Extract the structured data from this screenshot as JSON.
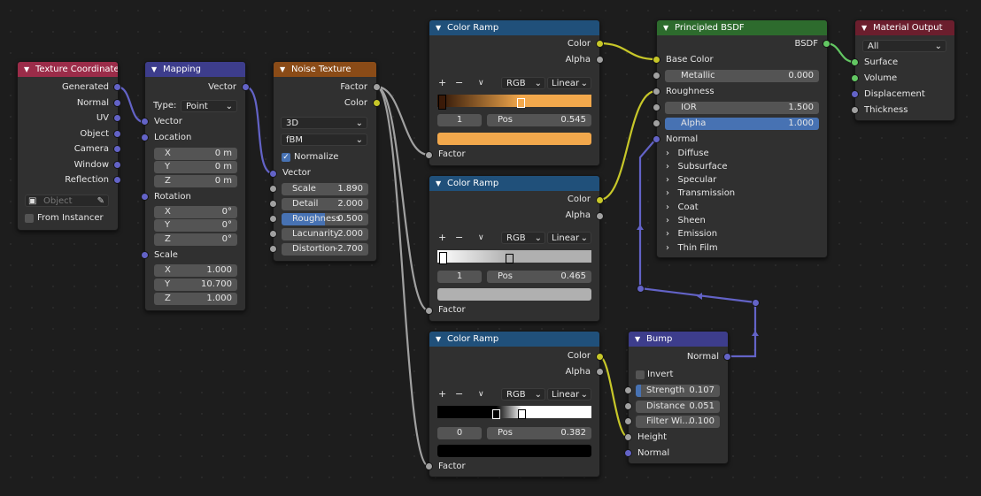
{
  "colors": {
    "frame_red": "#9b2c49",
    "vector_blue": "#3d3d8c",
    "texture_orange": "#8a4b17",
    "converter_blue": "#20507a",
    "shader_green": "#2d6b2d",
    "output_red": "#6b1e2d"
  },
  "texture_coordinate": {
    "title": "Texture Coordinate",
    "outputs": [
      "Generated",
      "Normal",
      "UV",
      "Object",
      "Camera",
      "Window",
      "Reflection"
    ],
    "object_placeholder": "Object",
    "from_instancer": "From Instancer"
  },
  "mapping": {
    "title": "Mapping",
    "out_vector": "Vector",
    "type_label": "Type:",
    "type_value": "Point",
    "in_vector": "Vector",
    "location": "Location",
    "rotation": "Rotation",
    "scale": "Scale",
    "loc": [
      {
        "a": "X",
        "v": "0 m"
      },
      {
        "a": "Y",
        "v": "0 m"
      },
      {
        "a": "Z",
        "v": "0 m"
      }
    ],
    "rot": [
      {
        "a": "X",
        "v": "0°"
      },
      {
        "a": "Y",
        "v": "0°"
      },
      {
        "a": "Z",
        "v": "0°"
      }
    ],
    "scl": [
      {
        "a": "X",
        "v": "1.000"
      },
      {
        "a": "Y",
        "v": "10.700"
      },
      {
        "a": "Z",
        "v": "1.000"
      }
    ]
  },
  "noise": {
    "title": "Noise Texture",
    "out_factor": "Factor",
    "out_color": "Color",
    "dim": "3D",
    "type": "fBM",
    "normalize": "Normalize",
    "in_vector": "Vector",
    "params": [
      {
        "k": "Scale",
        "v": "1.890"
      },
      {
        "k": "Detail",
        "v": "2.000"
      },
      {
        "k": "Roughness",
        "v": "0.500"
      },
      {
        "k": "Lacunarity",
        "v": "2.000"
      },
      {
        "k": "Distortion",
        "v": "-2.700"
      }
    ]
  },
  "ramp1": {
    "title": "Color Ramp",
    "color": "Color",
    "alpha": "Alpha",
    "plus": "+",
    "minus": "−",
    "chev": "∨",
    "mode": "RGB",
    "interp": "Linear",
    "index": "1",
    "pos_label": "Pos",
    "pos": "0.545",
    "factor": "Factor",
    "swatch": "#f2a84c"
  },
  "ramp2": {
    "title": "Color Ramp",
    "color": "Color",
    "alpha": "Alpha",
    "plus": "+",
    "minus": "−",
    "chev": "∨",
    "mode": "RGB",
    "interp": "Linear",
    "index": "1",
    "pos_label": "Pos",
    "pos": "0.465",
    "factor": "Factor",
    "swatch": "#b0b0b0"
  },
  "ramp3": {
    "title": "Color Ramp",
    "color": "Color",
    "alpha": "Alpha",
    "plus": "+",
    "minus": "−",
    "chev": "∨",
    "mode": "RGB",
    "interp": "Linear",
    "index": "0",
    "pos_label": "Pos",
    "pos": "0.382",
    "factor": "Factor",
    "swatch": "#000000"
  },
  "bsdf": {
    "title": "Principled BSDF",
    "out": "BSDF",
    "base_color": "Base Color",
    "metallic": "Metallic",
    "metallic_v": "0.000",
    "roughness": "Roughness",
    "ior": "IOR",
    "ior_v": "1.500",
    "alpha": "Alpha",
    "alpha_v": "1.000",
    "normal": "Normal",
    "panels": [
      "Diffuse",
      "Subsurface",
      "Specular",
      "Transmission",
      "Coat",
      "Sheen",
      "Emission",
      "Thin Film"
    ]
  },
  "bump": {
    "title": "Bump",
    "out_normal": "Normal",
    "invert": "Invert",
    "params": [
      {
        "k": "Strength",
        "v": "0.107"
      },
      {
        "k": "Distance",
        "v": "0.051"
      },
      {
        "k": "Filter Wi...",
        "v": "0.100"
      }
    ],
    "height": "Height",
    "normal": "Normal"
  },
  "output": {
    "title": "Material Output",
    "target": "All",
    "inputs": [
      "Surface",
      "Volume",
      "Displacement",
      "Thickness"
    ]
  }
}
